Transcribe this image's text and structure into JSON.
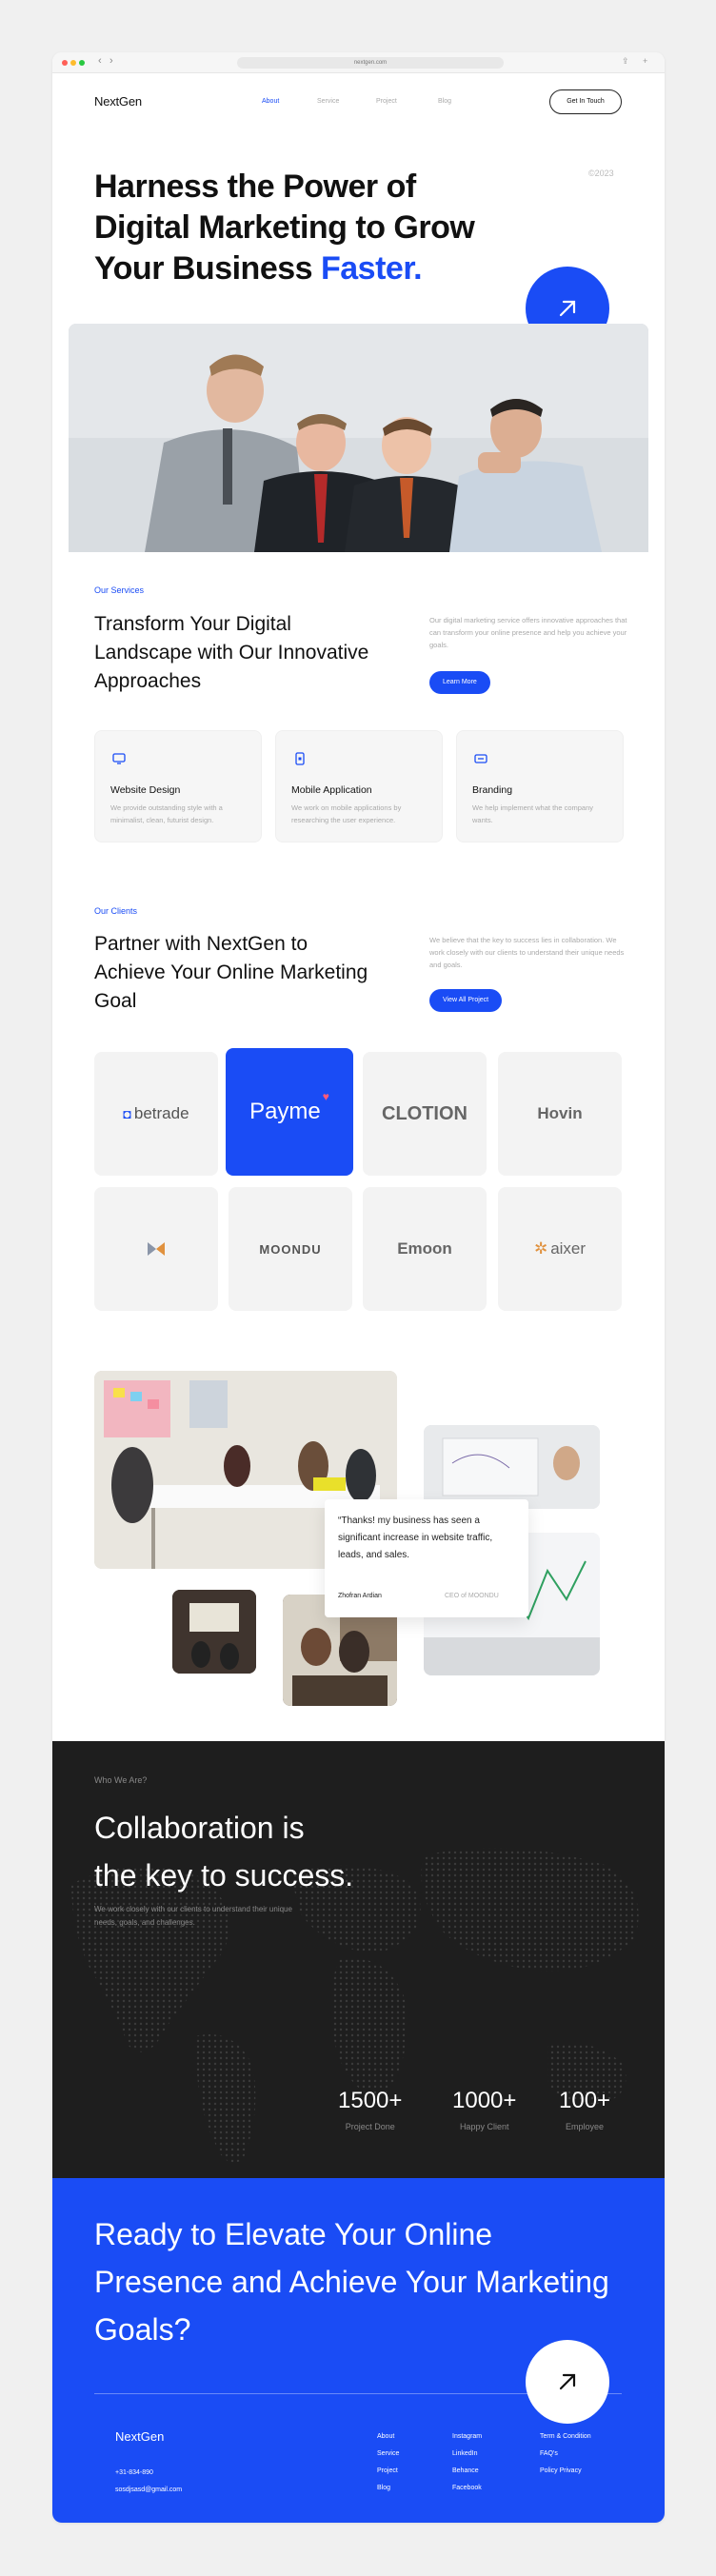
{
  "browser": {
    "url": "nextgen.com"
  },
  "nav": {
    "logo": "NextGen",
    "links": [
      "About",
      "Service",
      "Project",
      "Blog"
    ],
    "cta": "Get In Touch"
  },
  "hero": {
    "title_line1": "Harness the Power of",
    "title_line2": "Digital Marketing to Grow",
    "title_line3": "Your Business",
    "title_accent": "Faster.",
    "year": "©2023"
  },
  "services": {
    "eyebrow": "Our Services",
    "title": "Transform Your Digital Landscape with Our Innovative Approaches",
    "description": "Our digital marketing service offers innovative approaches that can transform your online presence and help you achieve your goals.",
    "button": "Learn More",
    "cards": [
      {
        "icon": "monitor-icon",
        "title": "Website Design",
        "desc": "We provide outstanding style with a minimalist, clean, futurist design."
      },
      {
        "icon": "mobile-icon",
        "title": "Mobile Application",
        "desc": "We work on mobile applications by researching the user experience."
      },
      {
        "icon": "brand-icon",
        "title": "Branding",
        "desc": "We help implement what the company wants."
      }
    ]
  },
  "clients": {
    "eyebrow": "Our Clients",
    "title": "Partner with NextGen to Achieve Your Online Marketing Goal",
    "description": "We believe that the key to success lies in collaboration. We work closely with our clients to understand their unique needs and goals.",
    "button": "View All Project",
    "logos": [
      "betrade",
      "Payme",
      "CLOTION",
      "Hovin",
      "",
      "MOONDU",
      "Emoon",
      "aixer"
    ]
  },
  "testimonial": {
    "quote": "“Thanks! my business has seen a significant increase in website traffic, leads, and sales.",
    "name": "Zhofran Ardian",
    "role": "CEO of MOONDU"
  },
  "about": {
    "eyebrow": "Who We Are?",
    "title_line1": "Collaboration is",
    "title_line2": "the key to success.",
    "description": "We work closely with our clients to understand their unique needs, goals, and challenges.",
    "stats": [
      {
        "value": "1500+",
        "label": "Project Done"
      },
      {
        "value": "1000+",
        "label": "Happy Client"
      },
      {
        "value": "100+",
        "label": "Employee"
      }
    ]
  },
  "cta_section": {
    "title": "Ready to Elevate Your Online Presence and Achieve Your Marketing Goals?"
  },
  "footer": {
    "logo": "NextGen",
    "phone": "+31-834-890",
    "email": "sosdjsasd@gmail.com",
    "col1": [
      "About",
      "Service",
      "Project",
      "Blog"
    ],
    "col2": [
      "Instagram",
      "LinkedIn",
      "Behance",
      "Facebook"
    ],
    "col3": [
      "Term & Condition",
      "FAQ's",
      "Policy Privacy"
    ]
  },
  "colors": {
    "accent": "#1a4cf5",
    "dark": "#1e1e1e"
  }
}
